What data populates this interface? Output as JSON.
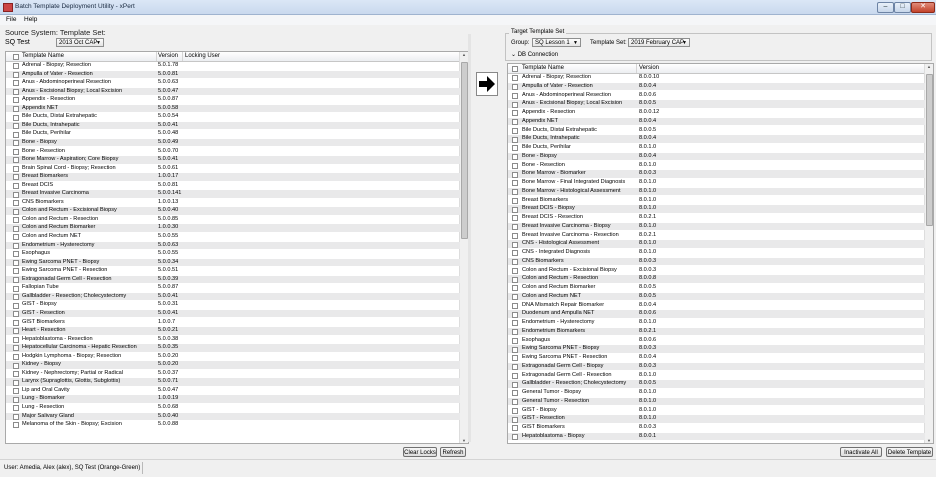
{
  "app": {
    "title": "Batch Template Deployment Utility - xPert",
    "window_buttons": [
      "–",
      "□",
      "✕"
    ]
  },
  "menu": [
    "File",
    "Help"
  ],
  "source": {
    "section_title": "Source System: Template Set:",
    "system_label": "SQ Test",
    "template_set": "2013 Oct CAP",
    "columns": [
      "Template Name",
      "Version",
      "Locking User"
    ],
    "rows": [
      [
        "Adrenal - Biopsy; Resection",
        "5.0.1.78",
        ""
      ],
      [
        "Ampulla of Vater - Resection",
        "5.0.0.81",
        ""
      ],
      [
        "Anus - Abdominoperineal Resection",
        "5.0.0.63",
        ""
      ],
      [
        "Anus - Excisional Biopsy; Local Excision",
        "5.0.0.47",
        ""
      ],
      [
        "Appendix - Resection",
        "5.0.0.87",
        ""
      ],
      [
        "Appendix NET",
        "5.0.0.58",
        ""
      ],
      [
        "Bile Ducts, Distal Extrahepatic",
        "5.0.0.54",
        ""
      ],
      [
        "Bile Ducts, Intrahepatic",
        "5.0.0.41",
        ""
      ],
      [
        "Bile Ducts, Perihilar",
        "5.0.0.48",
        ""
      ],
      [
        "Bone - Biopsy",
        "5.0.0.49",
        ""
      ],
      [
        "Bone - Resection",
        "5.0.0.70",
        ""
      ],
      [
        "Bone Marrow - Aspiration; Core Biopsy",
        "5.0.0.41",
        ""
      ],
      [
        "Brain Spinal Cord - Biopsy; Resection",
        "5.0.0.61",
        ""
      ],
      [
        "Breast Biomarkers",
        "1.0.0.17",
        ""
      ],
      [
        "Breast DCIS",
        "5.0.0.81",
        ""
      ],
      [
        "Breast Invasive Carcinoma",
        "5.0.0.141",
        ""
      ],
      [
        "CNS Biomarkers",
        "1.0.0.13",
        ""
      ],
      [
        "Colon and Rectum - Excisional Biopsy",
        "5.0.0.40",
        ""
      ],
      [
        "Colon and Rectum - Resection",
        "5.0.0.85",
        ""
      ],
      [
        "Colon and Rectum Biomarker",
        "1.0.0.30",
        ""
      ],
      [
        "Colon and Rectum NET",
        "5.0.0.55",
        ""
      ],
      [
        "Endometrium - Hysterectomy",
        "5.0.0.63",
        ""
      ],
      [
        "Esophagus",
        "5.0.0.55",
        ""
      ],
      [
        "Ewing Sarcoma PNET - Biopsy",
        "5.0.0.34",
        ""
      ],
      [
        "Ewing Sarcoma PNET - Resection",
        "5.0.0.51",
        ""
      ],
      [
        "Extragonadal Germ Cell - Resection",
        "5.0.0.39",
        ""
      ],
      [
        "Fallopian Tube",
        "5.0.0.87",
        ""
      ],
      [
        "Gallbladder - Resection; Cholecystectomy",
        "5.0.0.41",
        ""
      ],
      [
        "GIST - Biopsy",
        "5.0.0.31",
        ""
      ],
      [
        "GIST - Resection",
        "5.0.0.41",
        ""
      ],
      [
        "GIST Biomarkers",
        "1.0.0.7",
        ""
      ],
      [
        "Heart - Resection",
        "5.0.0.21",
        ""
      ],
      [
        "Hepatoblastoma - Resection",
        "5.0.0.38",
        ""
      ],
      [
        "Hepatocellular Carcinoma - Hepatic Resection",
        "5.0.0.35",
        ""
      ],
      [
        "Hodgkin Lymphoma - Biopsy; Resection",
        "5.0.0.20",
        ""
      ],
      [
        "Kidney - Biopsy",
        "5.0.0.20",
        ""
      ],
      [
        "Kidney - Nephrectomy; Partial or Radical",
        "5.0.0.37",
        ""
      ],
      [
        "Larynx (Supraglottis, Glottis, Subglottis)",
        "5.0.0.71",
        ""
      ],
      [
        "Lip and Oral Cavity",
        "5.0.0.47",
        ""
      ],
      [
        "Lung - Biomarker",
        "1.0.0.19",
        ""
      ],
      [
        "Lung - Resection",
        "5.0.0.68",
        ""
      ],
      [
        "Major Salivary Gland",
        "5.0.0.40",
        ""
      ],
      [
        "Melanoma of the Skin - Biopsy; Excision",
        "5.0.0.88",
        ""
      ]
    ],
    "buttons": {
      "clear_locks": "Clear Locks",
      "refresh": "Refresh"
    }
  },
  "target": {
    "groupbox_title": "Target Template Set",
    "group_label": "Group:",
    "group_value": "SQ Lesson 1",
    "template_set_label": "Template Set:",
    "template_set_value": "2019 February CAP",
    "db_connection_label": "DB Connection",
    "columns": [
      "Template Name",
      "Version"
    ],
    "rows": [
      [
        "Adrenal - Biopsy; Resection",
        "8.0.0.10"
      ],
      [
        "Ampulla of Vater - Resection",
        "8.0.0.4"
      ],
      [
        "Anus - Abdominoperineal Resection",
        "8.0.0.6"
      ],
      [
        "Anus - Excisional Biopsy; Local Excision",
        "8.0.0.5"
      ],
      [
        "Appendix - Resection",
        "8.0.0.12"
      ],
      [
        "Appendix NET",
        "8.0.0.4"
      ],
      [
        "Bile Ducts, Distal Extrahepatic",
        "8.0.0.5"
      ],
      [
        "Bile Ducts, Intrahepatic",
        "8.0.0.4"
      ],
      [
        "Bile Ducts, Perihilar",
        "8.0.1.0"
      ],
      [
        "Bone - Biopsy",
        "8.0.0.4"
      ],
      [
        "Bone - Resection",
        "8.0.1.0"
      ],
      [
        "Bone Marrow - Biomarker",
        "8.0.0.3"
      ],
      [
        "Bone Marrow - Final Integrated Diagnosis",
        "8.0.1.0"
      ],
      [
        "Bone Marrow - Histological Assessment",
        "8.0.1.0"
      ],
      [
        "Breast Biomarkers",
        "8.0.1.0"
      ],
      [
        "Breast DCIS - Biopsy",
        "8.0.1.0"
      ],
      [
        "Breast DCIS - Resection",
        "8.0.2.1"
      ],
      [
        "Breast Invasive Carcinoma - Biopsy",
        "8.0.1.0"
      ],
      [
        "Breast Invasive Carcinoma - Resection",
        "8.0.2.1"
      ],
      [
        "CNS - Histological Assessment",
        "8.0.1.0"
      ],
      [
        "CNS - Integrated Diagnosis",
        "8.0.1.0"
      ],
      [
        "CNS Biomarkers",
        "8.0.0.3"
      ],
      [
        "Colon and Rectum - Excisional Biopsy",
        "8.0.0.3"
      ],
      [
        "Colon and Rectum - Resection",
        "8.0.0.8"
      ],
      [
        "Colon and Rectum Biomarker",
        "8.0.0.5"
      ],
      [
        "Colon and Rectum NET",
        "8.0.0.5"
      ],
      [
        "DNA Mismatch Repair Biomarker",
        "8.0.0.4"
      ],
      [
        "Duodenum and Ampulla NET",
        "8.0.0.6"
      ],
      [
        "Endometrium - Hysterectomy",
        "8.0.1.0"
      ],
      [
        "Endometrium Biomarkers",
        "8.0.2.1"
      ],
      [
        "Esophagus",
        "8.0.0.6"
      ],
      [
        "Ewing Sarcoma PNET - Biopsy",
        "8.0.0.3"
      ],
      [
        "Ewing Sarcoma PNET - Resection",
        "8.0.0.4"
      ],
      [
        "Extragonadal Germ Cell - Biopsy",
        "8.0.0.3"
      ],
      [
        "Extragonadal Germ Cell - Resection",
        "8.0.1.0"
      ],
      [
        "Gallbladder - Resection; Cholecystectomy",
        "8.0.0.5"
      ],
      [
        "General Tumor - Biopsy",
        "8.0.1.0"
      ],
      [
        "General Tumor - Resection",
        "8.0.1.0"
      ],
      [
        "GIST - Biopsy",
        "8.0.1.0"
      ],
      [
        "GIST - Resection",
        "8.0.1.0"
      ],
      [
        "GIST Biomarkers",
        "8.0.0.3"
      ],
      [
        "Hepatoblastoma - Biopsy",
        "8.0.0.1"
      ]
    ],
    "buttons": {
      "inactivate_all": "Inactivate All",
      "delete_template": "Delete Template"
    }
  },
  "status": {
    "text": "User: Amedia, Alex (alex), SQ Test (Orange-Green)"
  }
}
